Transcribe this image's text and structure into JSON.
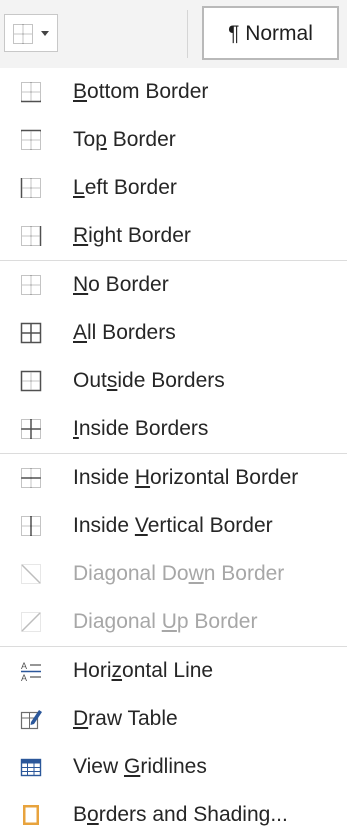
{
  "toolbar": {
    "borders_button_icon": "borders-grid-icon",
    "dropdown_icon": "caret-down-icon",
    "style_label": "¶ Normal"
  },
  "menu": {
    "items": [
      {
        "label": "Bottom Border",
        "underline": "B",
        "icon": "bottom-border-icon",
        "disabled": false
      },
      {
        "label": "Top Border",
        "underline": "p",
        "icon": "top-border-icon",
        "disabled": false
      },
      {
        "label": "Left Border",
        "underline": "L",
        "icon": "left-border-icon",
        "disabled": false
      },
      {
        "label": "Right Border",
        "underline": "R",
        "icon": "right-border-icon",
        "disabled": false
      },
      {
        "label": "No Border",
        "underline": "N",
        "icon": "no-border-icon",
        "disabled": false
      },
      {
        "label": "All Borders",
        "underline": "A",
        "icon": "all-borders-icon",
        "disabled": false
      },
      {
        "label": "Outside Borders",
        "underline": "s",
        "icon": "outside-borders-icon",
        "disabled": false
      },
      {
        "label": "Inside Borders",
        "underline": "I",
        "icon": "inside-borders-icon",
        "disabled": false
      },
      {
        "label": "Inside Horizontal Border",
        "underline": "H",
        "icon": "inside-horizontal-border-icon",
        "disabled": false
      },
      {
        "label": "Inside Vertical Border",
        "underline": "V",
        "icon": "inside-vertical-border-icon",
        "disabled": false
      },
      {
        "label": "Diagonal Down Border",
        "underline": "w",
        "icon": "diagonal-down-border-icon",
        "disabled": true
      },
      {
        "label": "Diagonal Up Border",
        "underline": "U",
        "icon": "diagonal-up-border-icon",
        "disabled": true
      },
      {
        "label": "Horizontal Line",
        "underline": "z",
        "icon": "horizontal-line-icon",
        "disabled": false
      },
      {
        "label": "Draw Table",
        "underline": "D",
        "icon": "draw-table-icon",
        "disabled": false
      },
      {
        "label": "View Gridlines",
        "underline": "G",
        "icon": "view-gridlines-icon",
        "disabled": false
      },
      {
        "label": "Borders and Shading...",
        "underline": "o",
        "icon": "borders-and-shading-icon",
        "disabled": false
      }
    ]
  },
  "colors": {
    "icon_gray": "#6d6d6d",
    "icon_dotted": "#8a8a8a",
    "icon_disabled": "#bdbdbd",
    "accent_blue": "#2b579a",
    "accent_orange": "#e8a33d",
    "disabled_text": "#a7a7a7"
  }
}
